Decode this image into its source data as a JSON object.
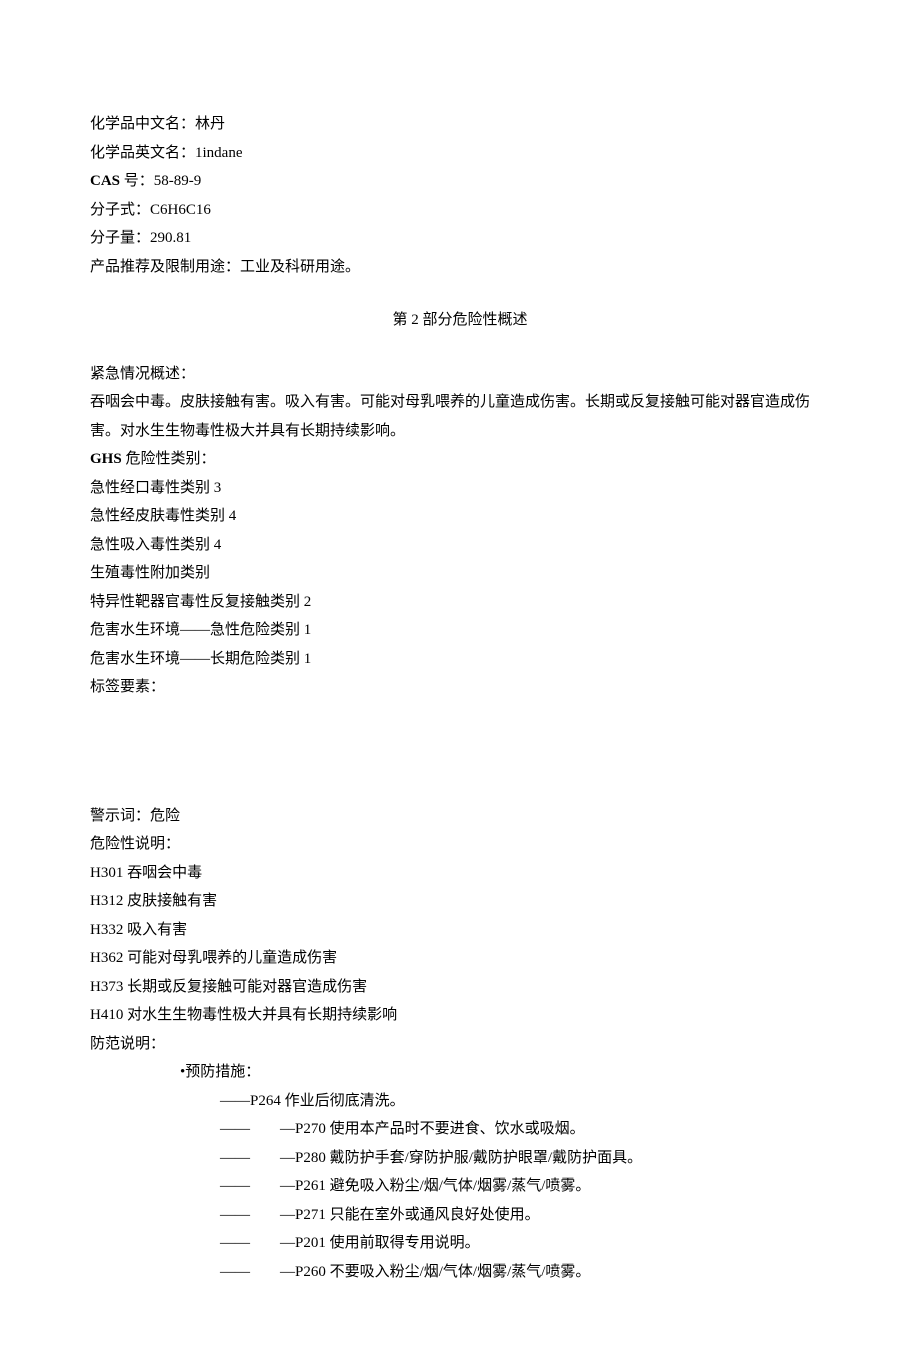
{
  "identification": {
    "chinese_name_label": "化学品中文名：",
    "chinese_name_value": "林丹",
    "english_name_label": "化学品英文名：",
    "english_name_value": "1indane",
    "cas_label": "CAS",
    "cas_label_cn": " 号：",
    "cas_value": "58-89-9",
    "formula_label": "分子式：",
    "formula_value": "C6H6C16",
    "mw_label": "分子量：",
    "mw_value": "290.81",
    "usage_label": "产品推荐及限制用途：",
    "usage_value": "工业及科研用途。"
  },
  "section2_title": "第 2 部分危险性概述",
  "emergency": {
    "label": "紧急情况概述：",
    "text": "吞咽会中毒。皮肤接触有害。吸入有害。可能对母乳喂养的儿童造成伤害。长期或反复接触可能对器官造成伤害。对水生生物毒性极大并具有长期持续影响。"
  },
  "ghs": {
    "label_bold": "GHS",
    "label_cn": " 危险性类别：",
    "categories": [
      "急性经口毒性类别 3",
      "急性经皮肤毒性类别 4",
      "急性吸入毒性类别 4",
      "生殖毒性附加类别",
      "特异性靶器官毒性反复接触类别 2",
      "危害水生环境——急性危险类别 1",
      "危害水生环境——长期危险类别 1"
    ]
  },
  "label_elements": "标签要素：",
  "signal_word": "警示词：危险",
  "hazard_statements": {
    "label": "危险性说明：",
    "items": [
      "H301 吞咽会中毒",
      "H312 皮肤接触有害",
      "H332 吸入有害",
      "H362 可能对母乳喂养的儿童造成伤害",
      "H373 长期或反复接触可能对器官造成伤害",
      "H410 对水生生物毒性极大并具有长期持续影响"
    ]
  },
  "precautionary": {
    "label": "防范说明：",
    "prevention_header": "•预防措施：",
    "items": [
      "——P264 作业后彻底清洗。",
      "——　　—P270 使用本产品时不要进食、饮水或吸烟。",
      "——　　—P280 戴防护手套/穿防护服/戴防护眼罩/戴防护面具。",
      "——　　—P261 避免吸入粉尘/烟/气体/烟雾/蒸气/喷雾。",
      "——　　—P271 只能在室外或通风良好处使用。",
      "——　　—P201 使用前取得专用说明。",
      "——　　—P260 不要吸入粉尘/烟/气体/烟雾/蒸气/喷雾。"
    ]
  }
}
